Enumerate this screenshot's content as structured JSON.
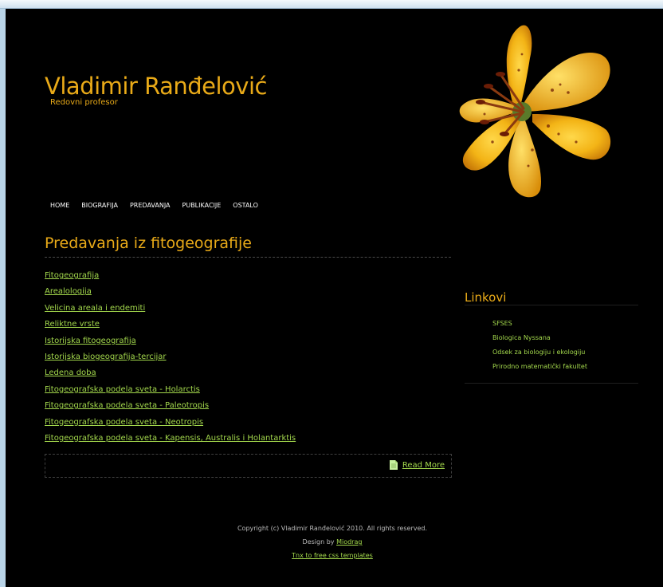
{
  "header": {
    "title": "Vladimir Ranđelović",
    "subtitle": "Redovni profesor"
  },
  "nav": {
    "items": [
      "HOME",
      "BIOGRAFIJA",
      "PREDAVANJA",
      "PUBLIKACIJE",
      "OSTALO"
    ]
  },
  "post": {
    "title": "Predavanja iz fitogeografije",
    "links": [
      "Fitogeografija",
      "Arealologija",
      "Velicina areala i endemiti",
      "Reliktne vrste",
      "Istorijska fitogeografija",
      "Istorijska biogeografija-tercijar",
      "Ledena doba",
      "Fitogeografska podela sveta - Holarctis",
      "Fitogeografska podela sveta - Paleotropis",
      "Fitogeografska podela sveta - Neotropis",
      "Fitogeografska podela sveta - Kapensis, Australis i Holantarktis"
    ],
    "read_more": "Read More"
  },
  "sidebar": {
    "title": "Linkovi",
    "links": [
      "SFSES",
      "Biologica Nyssana",
      "Odsek za biologiju i ekologiju",
      "Prirodno matematički fakultet"
    ]
  },
  "footer": {
    "copyright": "Copyright (c) Vladimir Ranđelović 2010. All rights reserved.",
    "design_by": "Design by",
    "designer": "Miodrag",
    "thanks": "Tnx to free css templates"
  },
  "colors": {
    "background": "#000000",
    "heading": "#e9aa18",
    "link": "#a3d84c"
  },
  "icons": [
    "lily-flower-image",
    "document-icon"
  ]
}
